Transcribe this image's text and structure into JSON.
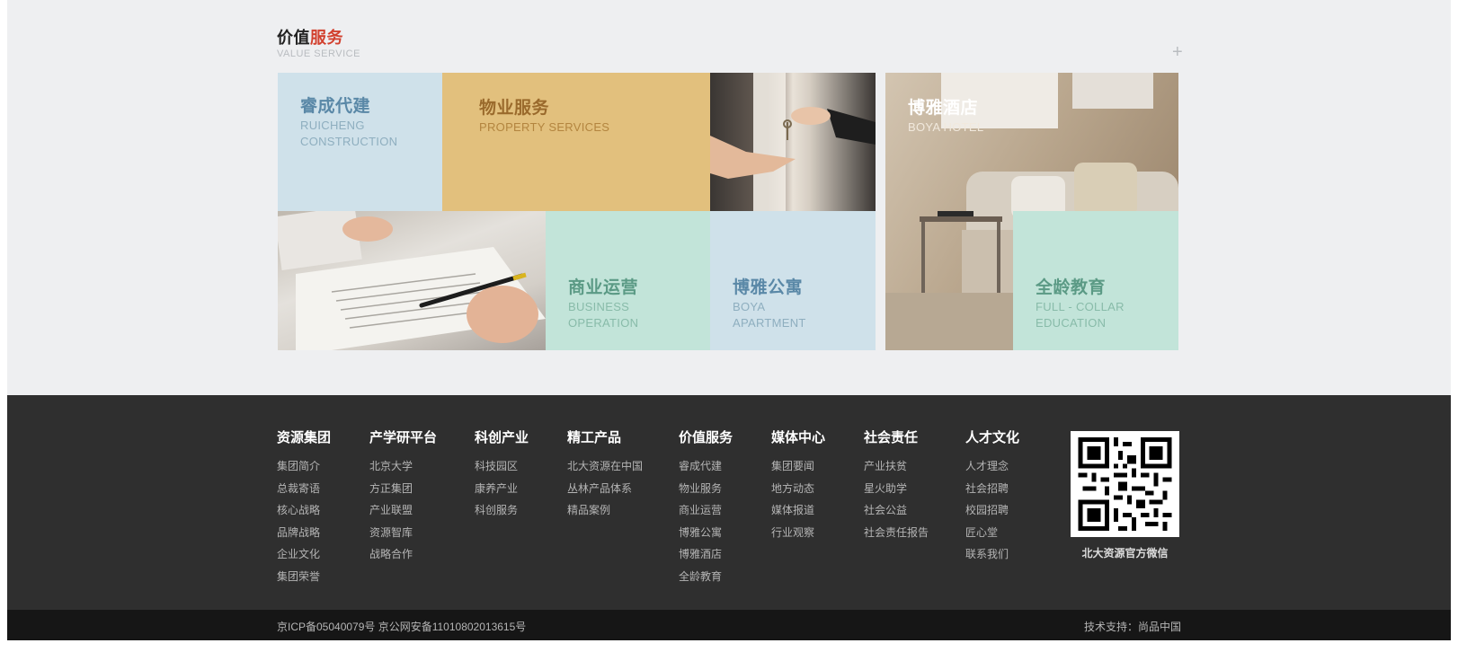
{
  "section": {
    "title_main": "价值",
    "title_accent": "服务",
    "subtitle": "VALUE SERVICE",
    "more_icon": "plus-icon"
  },
  "tiles": {
    "ruicheng": {
      "zh": "睿成代建",
      "en": "RUICHENG\nCONSTRUCTION"
    },
    "property": {
      "zh": "物业服务",
      "en": "PROPERTY SERVICES"
    },
    "business": {
      "zh": "商业运营",
      "en": "BUSINESS\nOPERATION"
    },
    "apartment": {
      "zh": "博雅公寓",
      "en": "BOYA\nAPARTMENT"
    },
    "hotel": {
      "zh": "博雅酒店",
      "en": "BOYA HOTEL"
    },
    "education": {
      "zh": "全龄教育",
      "en": "FULL - COLLAR\nEDUCATION"
    }
  },
  "footer": {
    "columns": [
      {
        "head": "资源集团",
        "links": [
          "集团简介",
          "总裁寄语",
          "核心战略",
          "品牌战略",
          "企业文化",
          "集团荣誉"
        ]
      },
      {
        "head": "产学研平台",
        "links": [
          "北京大学",
          "方正集团",
          "产业联盟",
          "资源智库",
          "战略合作"
        ]
      },
      {
        "head": "科创产业",
        "links": [
          "科技园区",
          "康养产业",
          "科创服务"
        ]
      },
      {
        "head": "精工产品",
        "links": [
          "北大资源在中国",
          "丛林产品体系",
          "精品案例"
        ]
      },
      {
        "head": "价值服务",
        "links": [
          "睿成代建",
          "物业服务",
          "商业运营",
          "博雅公寓",
          "博雅酒店",
          "全龄教育"
        ]
      },
      {
        "head": "媒体中心",
        "links": [
          "集团要闻",
          "地方动态",
          "媒体报道",
          "行业观察"
        ]
      },
      {
        "head": "社会责任",
        "links": [
          "产业扶贫",
          "星火助学",
          "社会公益",
          "社会责任报告"
        ]
      },
      {
        "head": "人才文化",
        "links": [
          "人才理念",
          "社会招聘",
          "校园招聘",
          "匠心堂",
          "联系我们"
        ]
      }
    ],
    "qr_caption": "北大资源官方微信",
    "icp": "京ICP备05040079号 京公网安备11010802013615号",
    "tech_support": "技术支持：尚品中国"
  },
  "colors": {
    "accent": "#d2412f",
    "footer_bg": "#2f2f2f",
    "bottom_bg": "#161616",
    "tile_blue": "#cfe1ea",
    "tile_gold": "#e2c07d",
    "tile_mint": "#c2e4d9"
  }
}
